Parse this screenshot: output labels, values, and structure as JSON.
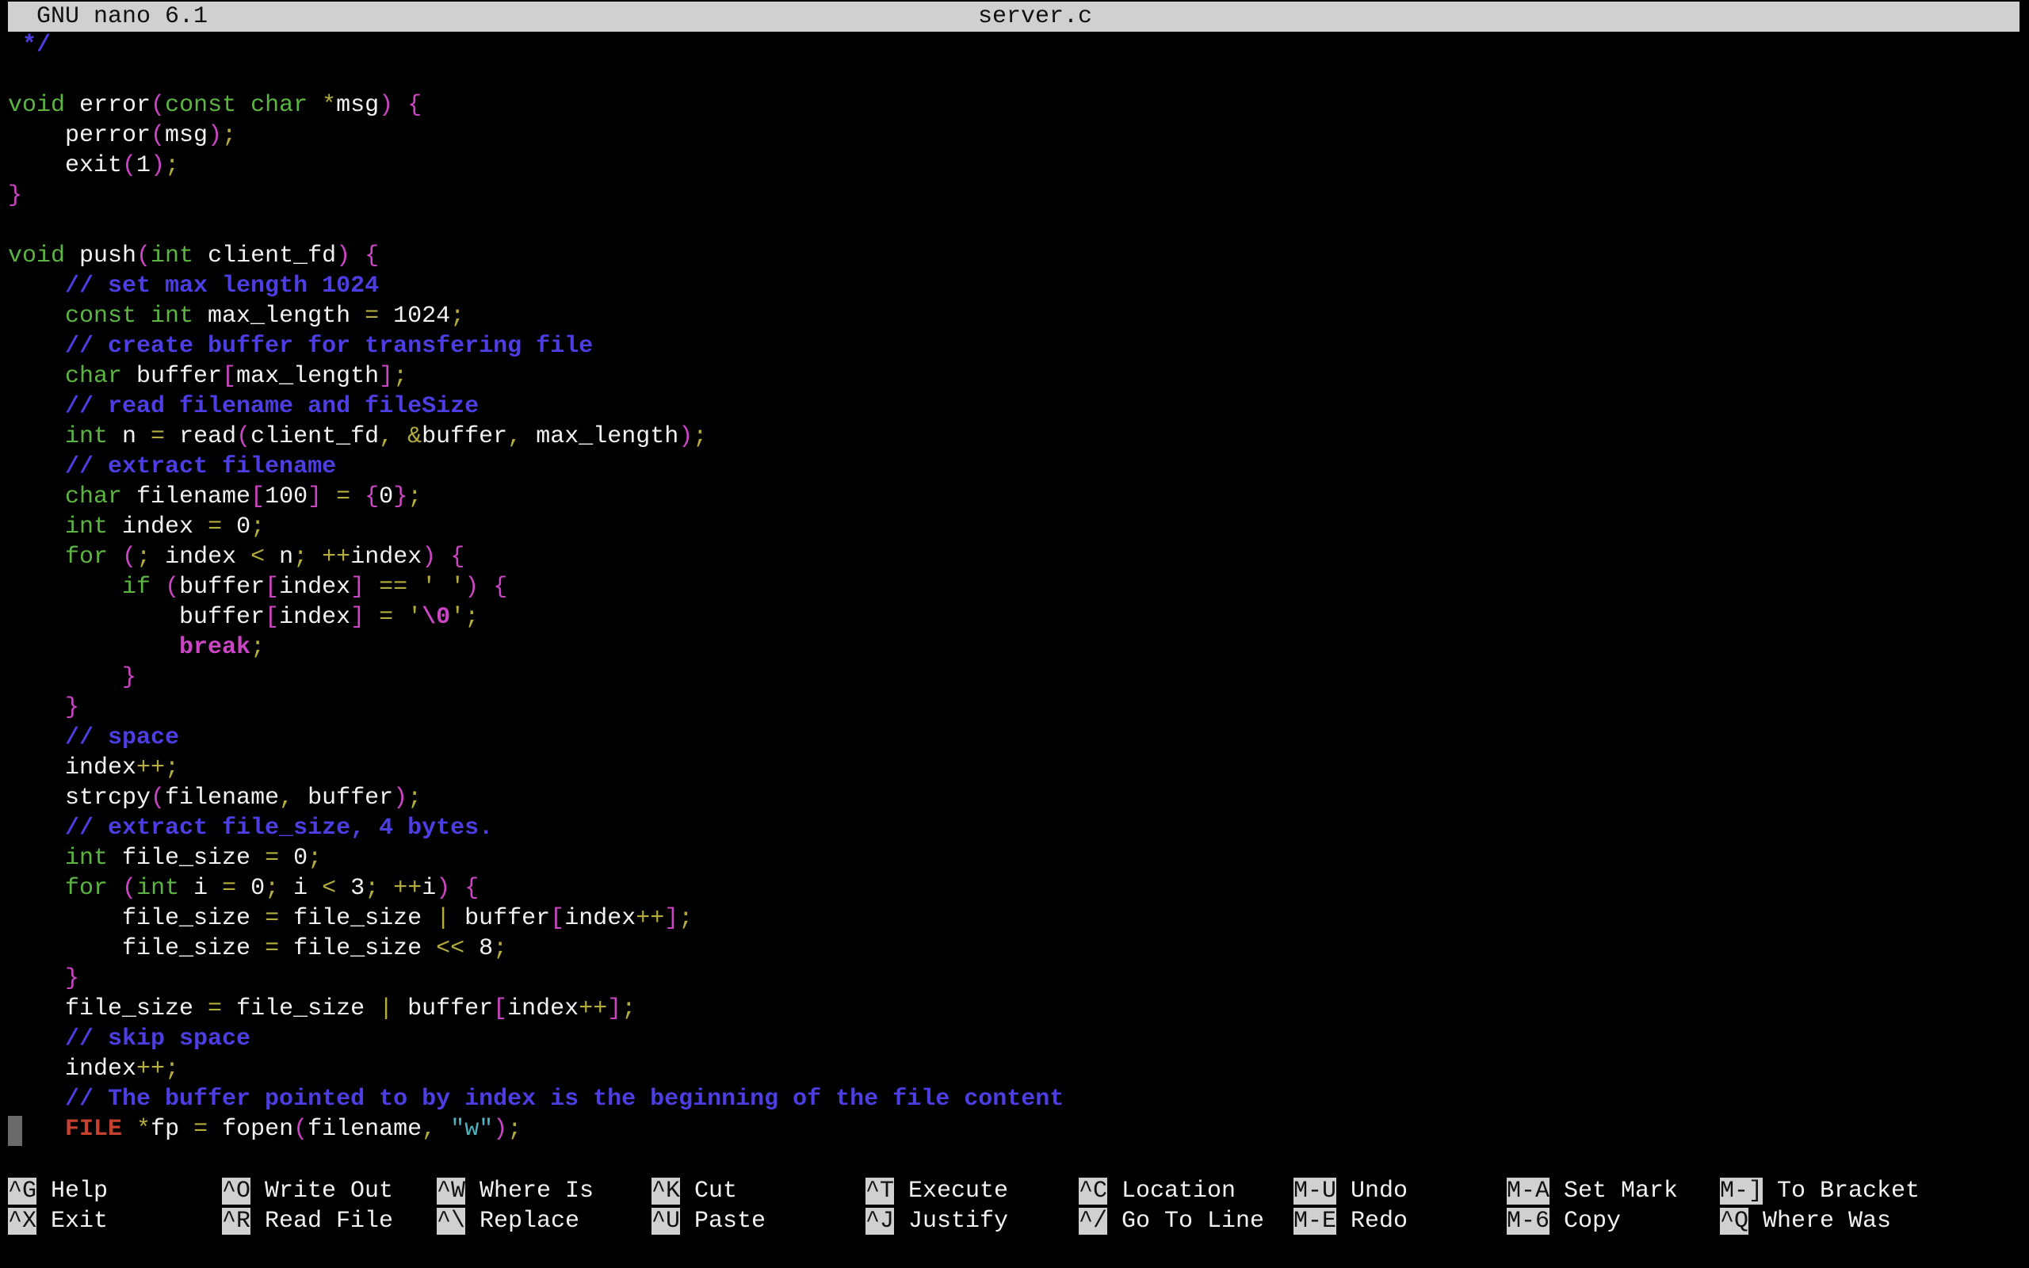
{
  "titlebar": {
    "app_name": "GNU nano 6.1",
    "file_name": "server.c"
  },
  "editor": {
    "lines": [
      [
        [
          "cm",
          " */"
        ]
      ],
      [],
      [
        [
          "kw",
          "void"
        ],
        [
          "tx",
          " error"
        ],
        [
          "br",
          "("
        ],
        [
          "kw",
          "const char"
        ],
        [
          "tx",
          " "
        ],
        [
          "op",
          "*"
        ],
        [
          "tx",
          "msg"
        ],
        [
          "br",
          ")"
        ],
        [
          "tx",
          " "
        ],
        [
          "br",
          "{"
        ]
      ],
      [
        [
          "tx",
          "    perror"
        ],
        [
          "br",
          "("
        ],
        [
          "tx",
          "msg"
        ],
        [
          "br",
          ")"
        ],
        [
          "op",
          ";"
        ]
      ],
      [
        [
          "tx",
          "    exit"
        ],
        [
          "br",
          "("
        ],
        [
          "tx",
          "1"
        ],
        [
          "br",
          ")"
        ],
        [
          "op",
          ";"
        ]
      ],
      [
        [
          "br",
          "}"
        ]
      ],
      [],
      [
        [
          "kw",
          "void"
        ],
        [
          "tx",
          " push"
        ],
        [
          "br",
          "("
        ],
        [
          "kw",
          "int"
        ],
        [
          "tx",
          " client_fd"
        ],
        [
          "br",
          ")"
        ],
        [
          "tx",
          " "
        ],
        [
          "br",
          "{"
        ]
      ],
      [
        [
          "tx",
          "    "
        ],
        [
          "cm",
          "// set max length 1024"
        ]
      ],
      [
        [
          "tx",
          "    "
        ],
        [
          "kw",
          "const int"
        ],
        [
          "tx",
          " max_length "
        ],
        [
          "op",
          "="
        ],
        [
          "tx",
          " 1024"
        ],
        [
          "op",
          ";"
        ]
      ],
      [
        [
          "tx",
          "    "
        ],
        [
          "cm",
          "// create buffer for transfering file"
        ]
      ],
      [
        [
          "tx",
          "    "
        ],
        [
          "kw",
          "char"
        ],
        [
          "tx",
          " buffer"
        ],
        [
          "br",
          "["
        ],
        [
          "tx",
          "max_length"
        ],
        [
          "br",
          "]"
        ],
        [
          "op",
          ";"
        ]
      ],
      [
        [
          "tx",
          "    "
        ],
        [
          "cm",
          "// read filename and fileSize"
        ]
      ],
      [
        [
          "tx",
          "    "
        ],
        [
          "kw",
          "int"
        ],
        [
          "tx",
          " n "
        ],
        [
          "op",
          "="
        ],
        [
          "tx",
          " read"
        ],
        [
          "br",
          "("
        ],
        [
          "tx",
          "client_fd"
        ],
        [
          "op",
          ","
        ],
        [
          "tx",
          " "
        ],
        [
          "op",
          "&"
        ],
        [
          "tx",
          "buffer"
        ],
        [
          "op",
          ","
        ],
        [
          "tx",
          " max_length"
        ],
        [
          "br",
          ")"
        ],
        [
          "op",
          ";"
        ]
      ],
      [
        [
          "tx",
          "    "
        ],
        [
          "cm",
          "// extract filename"
        ]
      ],
      [
        [
          "tx",
          "    "
        ],
        [
          "kw",
          "char"
        ],
        [
          "tx",
          " filename"
        ],
        [
          "br",
          "["
        ],
        [
          "tx",
          "100"
        ],
        [
          "br",
          "]"
        ],
        [
          "tx",
          " "
        ],
        [
          "op",
          "="
        ],
        [
          "tx",
          " "
        ],
        [
          "br",
          "{"
        ],
        [
          "tx",
          "0"
        ],
        [
          "br",
          "}"
        ],
        [
          "op",
          ";"
        ]
      ],
      [
        [
          "tx",
          "    "
        ],
        [
          "kw",
          "int"
        ],
        [
          "tx",
          " index "
        ],
        [
          "op",
          "="
        ],
        [
          "tx",
          " 0"
        ],
        [
          "op",
          ";"
        ]
      ],
      [
        [
          "tx",
          "    "
        ],
        [
          "kw",
          "for"
        ],
        [
          "tx",
          " "
        ],
        [
          "br",
          "("
        ],
        [
          "op",
          ";"
        ],
        [
          "tx",
          " index "
        ],
        [
          "op",
          "<"
        ],
        [
          "tx",
          " n"
        ],
        [
          "op",
          ";"
        ],
        [
          "tx",
          " "
        ],
        [
          "op",
          "++"
        ],
        [
          "tx",
          "index"
        ],
        [
          "br",
          ")"
        ],
        [
          "tx",
          " "
        ],
        [
          "br",
          "{"
        ]
      ],
      [
        [
          "tx",
          "        "
        ],
        [
          "kw",
          "if"
        ],
        [
          "tx",
          " "
        ],
        [
          "br",
          "("
        ],
        [
          "tx",
          "buffer"
        ],
        [
          "br",
          "["
        ],
        [
          "tx",
          "index"
        ],
        [
          "br",
          "]"
        ],
        [
          "tx",
          " "
        ],
        [
          "op",
          "=="
        ],
        [
          "tx",
          " "
        ],
        [
          "op",
          "' '"
        ],
        [
          "br",
          ")"
        ],
        [
          "tx",
          " "
        ],
        [
          "br",
          "{"
        ]
      ],
      [
        [
          "tx",
          "            buffer"
        ],
        [
          "br",
          "["
        ],
        [
          "tx",
          "index"
        ],
        [
          "br",
          "]"
        ],
        [
          "tx",
          " "
        ],
        [
          "op",
          "="
        ],
        [
          "tx",
          " "
        ],
        [
          "op",
          "'"
        ],
        [
          "fl",
          "\\0"
        ],
        [
          "op",
          "'"
        ],
        [
          "op",
          ";"
        ]
      ],
      [
        [
          "tx",
          "            "
        ],
        [
          "fl",
          "break"
        ],
        [
          "op",
          ";"
        ]
      ],
      [
        [
          "tx",
          "        "
        ],
        [
          "br",
          "}"
        ]
      ],
      [
        [
          "tx",
          "    "
        ],
        [
          "br",
          "}"
        ]
      ],
      [
        [
          "tx",
          "    "
        ],
        [
          "cm",
          "// space"
        ]
      ],
      [
        [
          "tx",
          "    index"
        ],
        [
          "op",
          "++;"
        ]
      ],
      [
        [
          "tx",
          "    strcpy"
        ],
        [
          "br",
          "("
        ],
        [
          "tx",
          "filename"
        ],
        [
          "op",
          ","
        ],
        [
          "tx",
          " buffer"
        ],
        [
          "br",
          ")"
        ],
        [
          "op",
          ";"
        ]
      ],
      [
        [
          "tx",
          "    "
        ],
        [
          "cm",
          "// extract file_size, 4 bytes."
        ]
      ],
      [
        [
          "tx",
          "    "
        ],
        [
          "kw",
          "int"
        ],
        [
          "tx",
          " file_size "
        ],
        [
          "op",
          "="
        ],
        [
          "tx",
          " 0"
        ],
        [
          "op",
          ";"
        ]
      ],
      [
        [
          "tx",
          "    "
        ],
        [
          "kw",
          "for"
        ],
        [
          "tx",
          " "
        ],
        [
          "br",
          "("
        ],
        [
          "kw",
          "int"
        ],
        [
          "tx",
          " i "
        ],
        [
          "op",
          "="
        ],
        [
          "tx",
          " 0"
        ],
        [
          "op",
          ";"
        ],
        [
          "tx",
          " i "
        ],
        [
          "op",
          "<"
        ],
        [
          "tx",
          " 3"
        ],
        [
          "op",
          ";"
        ],
        [
          "tx",
          " "
        ],
        [
          "op",
          "++"
        ],
        [
          "tx",
          "i"
        ],
        [
          "br",
          ")"
        ],
        [
          "tx",
          " "
        ],
        [
          "br",
          "{"
        ]
      ],
      [
        [
          "tx",
          "        file_size "
        ],
        [
          "op",
          "="
        ],
        [
          "tx",
          " file_size "
        ],
        [
          "op",
          "|"
        ],
        [
          "tx",
          " buffer"
        ],
        [
          "br",
          "["
        ],
        [
          "tx",
          "index"
        ],
        [
          "op",
          "++"
        ],
        [
          "br",
          "]"
        ],
        [
          "op",
          ";"
        ]
      ],
      [
        [
          "tx",
          "        file_size "
        ],
        [
          "op",
          "="
        ],
        [
          "tx",
          " file_size "
        ],
        [
          "op",
          "<<"
        ],
        [
          "tx",
          " 8"
        ],
        [
          "op",
          ";"
        ]
      ],
      [
        [
          "tx",
          "    "
        ],
        [
          "br",
          "}"
        ]
      ],
      [
        [
          "tx",
          "    file_size "
        ],
        [
          "op",
          "="
        ],
        [
          "tx",
          " file_size "
        ],
        [
          "op",
          "|"
        ],
        [
          "tx",
          " buffer"
        ],
        [
          "br",
          "["
        ],
        [
          "tx",
          "index"
        ],
        [
          "op",
          "++"
        ],
        [
          "br",
          "]"
        ],
        [
          "op",
          ";"
        ]
      ],
      [
        [
          "tx",
          "    "
        ],
        [
          "cm",
          "// skip space"
        ]
      ],
      [
        [
          "tx",
          "    index"
        ],
        [
          "op",
          "++;"
        ]
      ],
      [
        [
          "tx",
          "    "
        ],
        [
          "cm",
          "// The buffer pointed to by index is the beginning of the file content"
        ]
      ],
      [
        [
          "tx",
          "    "
        ],
        [
          "ty",
          "FILE"
        ],
        [
          "tx",
          " "
        ],
        [
          "op",
          "*"
        ],
        [
          "tx",
          "fp "
        ],
        [
          "op",
          "="
        ],
        [
          "tx",
          " fopen"
        ],
        [
          "br",
          "("
        ],
        [
          "tx",
          "filename"
        ],
        [
          "op",
          ","
        ],
        [
          "tx",
          " "
        ],
        [
          "st",
          "\"w\""
        ],
        [
          "br",
          ")"
        ],
        [
          "op",
          ";"
        ]
      ]
    ]
  },
  "shortcuts": [
    [
      {
        "key": "^G",
        "label": "Help"
      },
      {
        "key": "^X",
        "label": "Exit"
      }
    ],
    [
      {
        "key": "^O",
        "label": "Write Out"
      },
      {
        "key": "^R",
        "label": "Read File"
      }
    ],
    [
      {
        "key": "^W",
        "label": "Where Is"
      },
      {
        "key": "^\\",
        "label": "Replace"
      }
    ],
    [
      {
        "key": "^K",
        "label": "Cut"
      },
      {
        "key": "^U",
        "label": "Paste"
      }
    ],
    [
      {
        "key": "^T",
        "label": "Execute"
      },
      {
        "key": "^J",
        "label": "Justify"
      }
    ],
    [
      {
        "key": "^C",
        "label": "Location"
      },
      {
        "key": "^/",
        "label": "Go To Line"
      }
    ],
    [
      {
        "key": "M-U",
        "label": "Undo"
      },
      {
        "key": "M-E",
        "label": "Redo"
      }
    ],
    [
      {
        "key": "M-A",
        "label": "Set Mark"
      },
      {
        "key": "M-6",
        "label": "Copy"
      }
    ],
    [
      {
        "key": "M-]",
        "label": "To Bracket"
      },
      {
        "key": "^Q",
        "label": "Where Was"
      }
    ]
  ]
}
